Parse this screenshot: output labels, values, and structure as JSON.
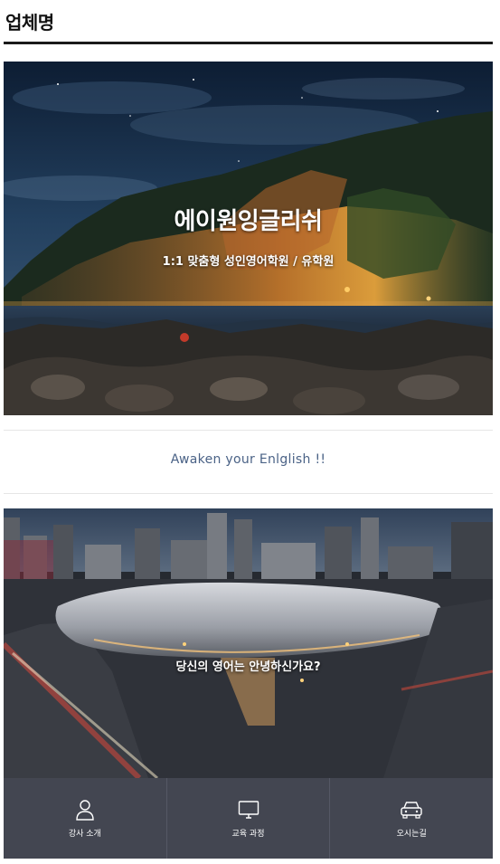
{
  "header": {
    "title": "업체명"
  },
  "hero": {
    "title": "에이원잉글리쉬",
    "subtitle": "1:1 맞춤형 성인영어학원 / 유학원"
  },
  "slogan": {
    "text": "Awaken your Enlglish !!"
  },
  "city": {
    "caption": "당신의 영어는 안녕하신가요?"
  },
  "bottom_nav": {
    "items": [
      {
        "label": "강사 소개",
        "icon": "person-icon"
      },
      {
        "label": "교육 과정",
        "icon": "monitor-icon"
      },
      {
        "label": "오시는길",
        "icon": "car-icon"
      }
    ]
  },
  "colors": {
    "header_rule": "#1a1a1a",
    "slogan_text": "#4a6286",
    "nav_background": "#434651"
  }
}
